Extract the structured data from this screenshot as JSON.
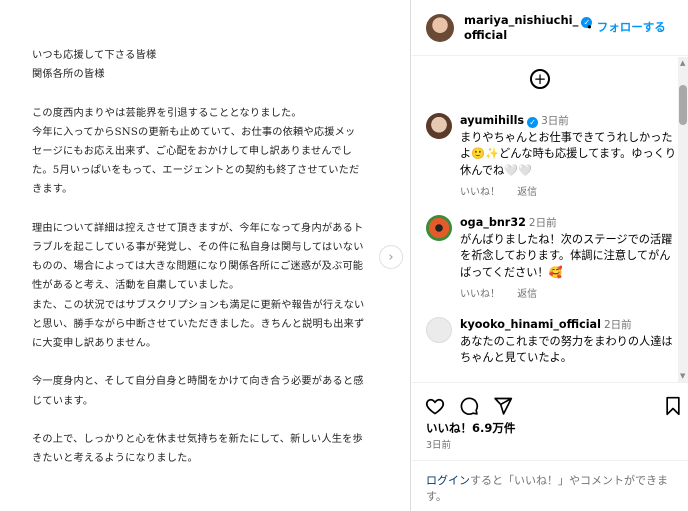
{
  "post": {
    "lines": [
      "いつも応援して下さる皆様",
      "関係各所の皆様",
      "",
      "この度西内まりやは芸能界を引退することとなりました。",
      "今年に入ってからSNSの更新も止めていて、お仕事の依頼や応援メッ",
      "セージにもお応え出来ず、ご心配をおかけして申し訳ありませんでし",
      "た。5月いっぱいをもって、エージェントとの契約も終了させていただ",
      "きます。",
      "",
      "理由について詳細は控えさせて頂きますが、今年になって身内があるト",
      "ラブルを起こしている事が発覚し、その件に私自身は関与してはいない",
      "ものの、場合によっては大きな問題になり関係各所にご迷惑が及ぶ可能",
      "性があると考え、活動を自粛していました。",
      "また、この状況ではサブスクリプションも満足に更新や報告が行えない",
      "と思い、勝手ながら中断させていただきました。きちんと説明も出来ず",
      "に大変申し訳ありません。",
      "",
      "今一度身内と、そして自分自身と時間をかけて向き合う必要があると感",
      "じています。",
      "",
      "その上で、しっかりと心を休ませ気持ちを新たにして、新しい人生を歩",
      "きたいと考えるようになりました。"
    ]
  },
  "header": {
    "username_line1": "mariya_nishiuchi_",
    "username_line2": "official",
    "separator": "•",
    "follow_label": "フォローする"
  },
  "comments": [
    {
      "username": "ayumihills",
      "time": "3日前",
      "text": "まりやちゃんとお仕事できてうれしかったよ🙂✨どんな時も応援してます。ゆっくり休んでね🤍🤍",
      "like_label": "いいね！",
      "reply_label": "返信",
      "avatar_color": "#c9a48c"
    },
    {
      "username": "oga_bnr32",
      "time": "2日前",
      "text": "がんばりましたね！次のステージでの活躍を祈念しております。体調に注意してがんばってください！🥰",
      "like_label": "いいね！",
      "reply_label": "返信",
      "avatar_color": "#d84a2a"
    },
    {
      "username": "kyooko_hinami_official",
      "time": "2日前",
      "text": "あなたのこれまでの努力をまわりの人達はちゃんと見ていたよ。",
      "avatar_color": "#e8e8e8"
    }
  ],
  "actions": {
    "like_icon": "heart-icon",
    "comment_icon": "comment-icon",
    "share_icon": "share-icon",
    "save_icon": "bookmark-icon"
  },
  "likes_text": "いいね！6.9万件",
  "date_text": "3日前",
  "footer": {
    "login_label": "ログイン",
    "rest_text": "すると「いいね！」やコメントができます。"
  }
}
